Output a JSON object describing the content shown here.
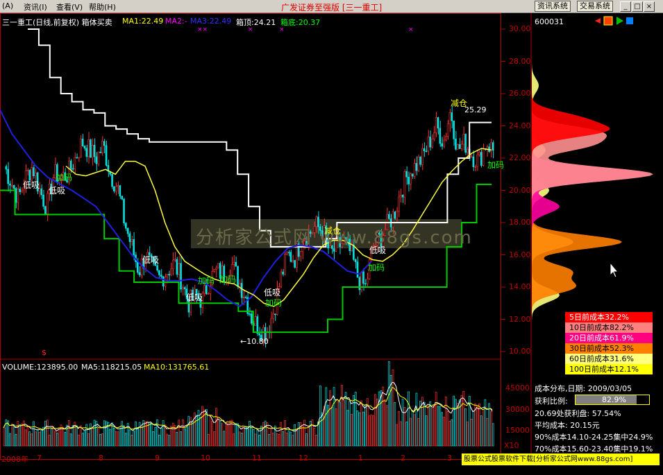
{
  "menubar": {
    "items": [
      {
        "label": "(A)"
      },
      {
        "label": "资讯(I)"
      },
      {
        "label": "查看(V)"
      },
      {
        "label": "帮助(H)"
      }
    ],
    "app_title": "广发证券至强版 [三一重工]",
    "buttons": [
      "资讯系统",
      "交易系统"
    ],
    "window_controls": [
      "_",
      "□",
      "×"
    ]
  },
  "chart_header": {
    "title": "三一重工(日线,前复权) 箱体买卖",
    "ma1": "MA1:22.49",
    "ma2": "MA2:-",
    "ma3": "MA3:22.49",
    "box_top": "箱顶:24.21",
    "box_bottom": "箱底:20.37",
    "colors": {
      "title": "#ffffff",
      "ma1": "#ffff00",
      "ma2": "#ff00ff",
      "ma3": "#0000ff",
      "box_top": "#ffffff",
      "box_bottom": "#00ff00"
    }
  },
  "price_axis": {
    "ticks": [
      "30.00",
      "28.00",
      "26.00",
      "24.00",
      "22.00",
      "20.00",
      "18.00",
      "16.00",
      "14.00",
      "12.00",
      "10.00"
    ]
  },
  "volume_header": {
    "volume": "VOLUME:123895.00",
    "ma5": "MA5:118215.05",
    "ma10": "MA10:131765.61"
  },
  "volume_axis": {
    "ticks": [
      "45000",
      "30000",
      "15000"
    ],
    "unit": "X10"
  },
  "time_axis": {
    "ticks": [
      "2008年",
      "7",
      "8",
      "9",
      "10",
      "11",
      "12",
      "1",
      "2",
      "3"
    ]
  },
  "annotations": {
    "low_label": "←10.80",
    "high_label": "25.29",
    "signals": [
      {
        "text": "低吸",
        "color": "#ffffff"
      },
      {
        "text": "加码",
        "color": "#00ff00"
      },
      {
        "text": "低吸",
        "color": "#ffffff"
      },
      {
        "text": "低吸",
        "color": "#ffffff"
      },
      {
        "text": "加码",
        "color": "#00ff00"
      },
      {
        "text": "加码",
        "color": "#00ff00"
      },
      {
        "text": "低吸",
        "color": "#ffffff"
      },
      {
        "text": "低吸",
        "color": "#ffffff"
      },
      {
        "text": "加码",
        "color": "#00ff00"
      },
      {
        "text": "减仓",
        "color": "#ffff00"
      },
      {
        "text": "低吸",
        "color": "#ffffff"
      },
      {
        "text": "加码",
        "color": "#00ff00"
      },
      {
        "text": "减仓",
        "color": "#ffff00"
      },
      {
        "text": "加码",
        "color": "#00ff00"
      }
    ],
    "dollar_mark": "$"
  },
  "watermark": "分析家公式网 www.88gs.com",
  "side_panel": {
    "code": "600031",
    "cost_rows": [
      {
        "label": "5日前成本32.2%",
        "bg": "#ff0000",
        "fg": "#ffffff"
      },
      {
        "label": "10日前成本82.2%",
        "bg": "#ff8080",
        "fg": "#000000"
      },
      {
        "label": "20日前成本61.9%",
        "bg": "#ff0080",
        "fg": "#ffffff"
      },
      {
        "label": "30日前成本52.3%",
        "bg": "#ff8000",
        "fg": "#000000"
      },
      {
        "label": "60日前成本31.6%",
        "bg": "#ffff80",
        "fg": "#000000"
      },
      {
        "label": "100日前成本12.1%",
        "bg": "#ffff00",
        "fg": "#000000"
      }
    ],
    "dist_title": "成本分布,日期: 2009/03/05",
    "profit_label": "获利比例:",
    "profit_value": "82.9%",
    "profit_ratio": 0.829,
    "profit_at": "20.69处获利盘: 57.54%",
    "avg_cost": "平均成本: 20.15元",
    "c90": "90%成本14.10-24.25集中24.9%",
    "c70": "70%成本15.60-23.40集中19.1%"
  },
  "footer": {
    "ad": "股票公式股票软件下载[分析家公式网www.88gs.com]"
  },
  "chart_data": {
    "type": "candlestick",
    "title": "三一重工(日线,前复权) 箱体买卖",
    "ylim": [
      10,
      30
    ],
    "y_ticks": [
      30,
      28,
      26,
      24,
      22,
      20,
      18,
      16,
      14,
      12,
      10
    ],
    "x_ticks": [
      "2008年",
      "7",
      "8",
      "9",
      "10",
      "11",
      "12",
      "1",
      "2",
      "3"
    ],
    "low": 10.8,
    "high": 25.29,
    "ma1_last": 22.49,
    "box_top_last": 24.21,
    "box_bottom_last": 20.37,
    "volume_last": 123895.0,
    "volume_ma5_last": 118215.05,
    "volume_ma10_last": 131765.61,
    "volume_ticks": [
      45000,
      30000,
      15000
    ],
    "close_path": [
      21.5,
      20.5,
      19.5,
      20.8,
      21.5,
      20,
      19,
      21,
      20.8,
      21,
      22,
      23,
      22.5,
      22,
      22.8,
      21,
      20.2,
      18,
      16.5,
      15,
      16,
      15,
      14.5,
      15,
      15.5,
      14.5,
      13,
      13.4,
      13.2,
      14.5,
      15,
      14.8,
      15.5,
      14.5,
      13.5,
      12,
      11.5,
      11.2,
      12.5,
      14.5,
      16,
      15.8,
      17,
      17.3,
      17.8,
      17.5,
      16,
      16.5,
      16.8,
      16,
      14.5,
      14,
      16.5,
      17,
      17.8,
      18.5,
      20,
      21,
      21.5,
      22,
      23,
      24,
      23,
      25,
      22.5,
      23,
      22.2,
      21.8,
      23,
      22.5
    ],
    "ma1_path": [
      21.5,
      21,
      20.9,
      21.1,
      21.3,
      21,
      21.8,
      21.8,
      21.5,
      20,
      18,
      16.5,
      15.6,
      15.2,
      14.8,
      14.5,
      14.3,
      14.2,
      13.8,
      13.5,
      13,
      12.8,
      13.2,
      14,
      14.8,
      15.8,
      16.6,
      16.9,
      16.9,
      16.6,
      16,
      15.7,
      15.6,
      16,
      16.6,
      17.5,
      18.5,
      19.5,
      20.5,
      21.2,
      21.8,
      22.3,
      22.6,
      22.5
    ],
    "ma3_path": [
      25,
      23.5,
      22.5,
      21.5,
      20.8,
      20.4,
      20,
      19.5,
      19,
      18,
      17,
      16,
      15.2,
      14.6,
      14.4,
      14.4,
      14.5,
      14.3,
      13.8,
      13.2,
      12.8,
      13.4,
      14.6,
      15.6,
      16.4,
      16.6,
      16.5,
      16.2,
      15.6,
      15,
      14.8,
      15.6
    ],
    "box_top_path": [
      30,
      29,
      27,
      26,
      25.5,
      25,
      24.8,
      24,
      23.8,
      23.5,
      23.2,
      23,
      23,
      23,
      23,
      23,
      23,
      23,
      22.5,
      21,
      19,
      17.5,
      16.5,
      16.5,
      16.5,
      16.5,
      16.5,
      17,
      18,
      18,
      18,
      18,
      18,
      18,
      18,
      18,
      18,
      18,
      21,
      22,
      24.21,
      24.21
    ],
    "box_bottom_path": [
      20,
      18.5,
      18.5,
      18.5,
      18.5,
      18.5,
      18.5,
      17,
      15,
      14.3,
      14.3,
      14.3,
      13,
      13,
      13,
      13,
      12.5,
      11.2,
      11.2,
      11.2,
      11.2,
      11.2,
      12,
      14,
      14,
      14,
      14,
      14,
      14,
      14,
      16.5,
      18,
      20.37
    ],
    "volume_bar_color": "#ffff00"
  }
}
